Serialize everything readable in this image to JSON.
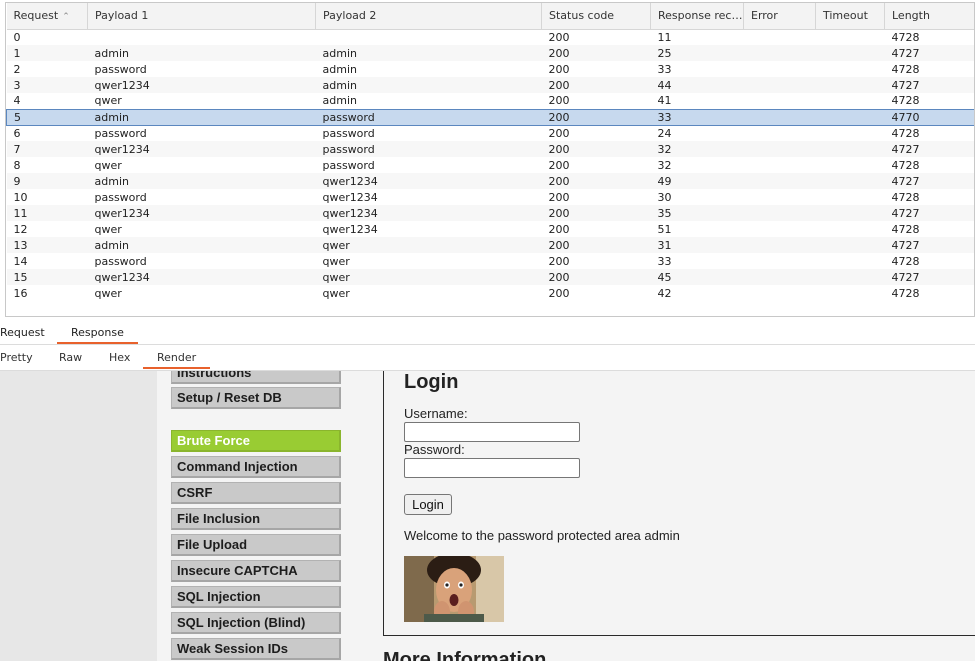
{
  "results": {
    "columns": [
      "Request",
      "Payload 1",
      "Payload 2",
      "Status code",
      "Response recei...",
      "Error",
      "Timeout",
      "Length"
    ],
    "selected_row": 5,
    "rows": [
      [
        "0",
        "",
        "",
        "200",
        "11",
        "",
        "",
        "4728"
      ],
      [
        "1",
        "admin",
        "admin",
        "200",
        "25",
        "",
        "",
        "4727"
      ],
      [
        "2",
        "password",
        "admin",
        "200",
        "33",
        "",
        "",
        "4728"
      ],
      [
        "3",
        "qwer1234",
        "admin",
        "200",
        "44",
        "",
        "",
        "4727"
      ],
      [
        "4",
        "qwer",
        "admin",
        "200",
        "41",
        "",
        "",
        "4728"
      ],
      [
        "5",
        "admin",
        "password",
        "200",
        "33",
        "",
        "",
        "4770"
      ],
      [
        "6",
        "password",
        "password",
        "200",
        "24",
        "",
        "",
        "4728"
      ],
      [
        "7",
        "qwer1234",
        "password",
        "200",
        "32",
        "",
        "",
        "4727"
      ],
      [
        "8",
        "qwer",
        "password",
        "200",
        "32",
        "",
        "",
        "4728"
      ],
      [
        "9",
        "admin",
        "qwer1234",
        "200",
        "49",
        "",
        "",
        "4727"
      ],
      [
        "10",
        "password",
        "qwer1234",
        "200",
        "30",
        "",
        "",
        "4728"
      ],
      [
        "11",
        "qwer1234",
        "qwer1234",
        "200",
        "35",
        "",
        "",
        "4727"
      ],
      [
        "12",
        "qwer",
        "qwer1234",
        "200",
        "51",
        "",
        "",
        "4728"
      ],
      [
        "13",
        "admin",
        "qwer",
        "200",
        "31",
        "",
        "",
        "4727"
      ],
      [
        "14",
        "password",
        "qwer",
        "200",
        "33",
        "",
        "",
        "4728"
      ],
      [
        "15",
        "qwer1234",
        "qwer",
        "200",
        "45",
        "",
        "",
        "4727"
      ],
      [
        "16",
        "qwer",
        "qwer",
        "200",
        "42",
        "",
        "",
        "4728"
      ]
    ]
  },
  "tabs": {
    "request": "Request",
    "response": "Response",
    "active": "Response"
  },
  "view_tabs": {
    "pretty": "Pretty",
    "raw": "Raw",
    "hex": "Hex",
    "render": "Render",
    "active": "Render"
  },
  "render": {
    "menu": {
      "instructions": "Instructions",
      "setup": "Setup / Reset DB",
      "brute_force": "Brute Force",
      "command_injection": "Command Injection",
      "csrf": "CSRF",
      "file_inclusion": "File Inclusion",
      "file_upload": "File Upload",
      "insecure_captcha": "Insecure CAPTCHA",
      "sql_injection": "SQL Injection",
      "sql_injection_blind": "SQL Injection (Blind)",
      "weak_session_ids": "Weak Session IDs"
    },
    "login": {
      "title": "Login",
      "username_label": "Username:",
      "password_label": "Password:",
      "button": "Login",
      "welcome": "Welcome to the password protected area admin"
    },
    "more_info": "More Information"
  },
  "colors": {
    "accent": "#e8612c",
    "selected_row": "#c7d9ee",
    "menu_active": "#99cc33"
  }
}
